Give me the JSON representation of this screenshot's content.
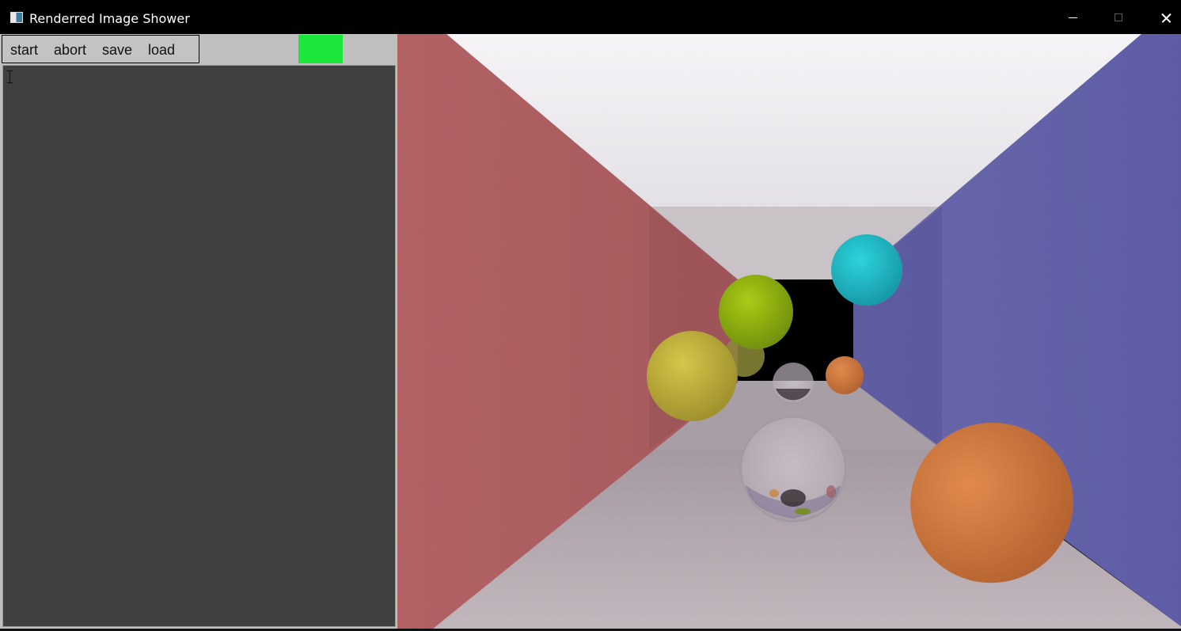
{
  "window": {
    "title": "Renderred Image Shower",
    "icon": "app-window-icon",
    "controls": [
      "minimize-icon",
      "maximize-icon",
      "close-icon"
    ]
  },
  "toolbar": {
    "buttons": [
      {
        "label": "start"
      },
      {
        "label": "abort"
      },
      {
        "label": "save"
      },
      {
        "label": "load"
      }
    ],
    "status_color": "#1de63a"
  },
  "log": {
    "text": ""
  },
  "render": {
    "scene": "room with red left wall, blue right wall, white ceiling and floor, colored diffuse spheres and two glass spheres",
    "colors": {
      "left_wall": "#b56466",
      "right_wall": "#5f5fa8",
      "ceiling": "#f0eef2",
      "floor": "#b9aeb4",
      "back_opening": "#000000"
    }
  }
}
